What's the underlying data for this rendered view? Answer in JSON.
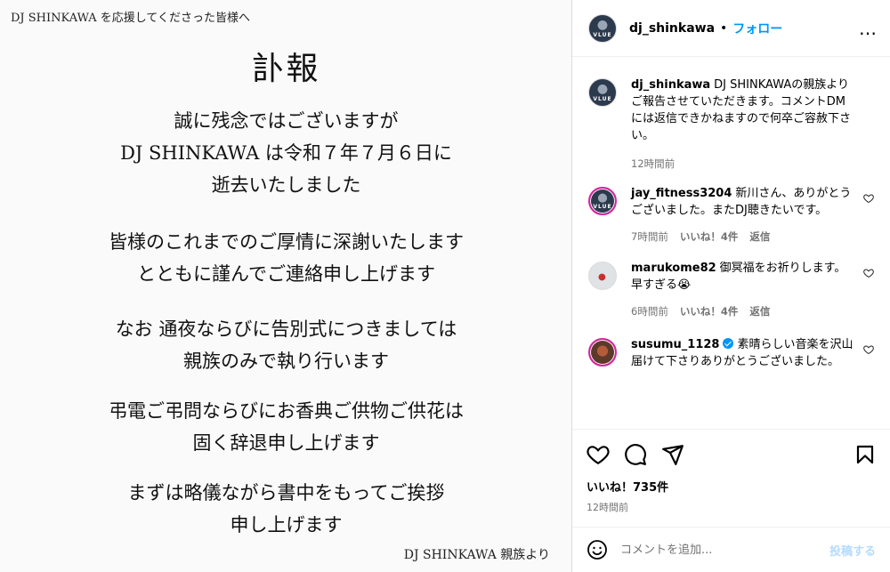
{
  "notice": {
    "header": "DJ SHINKAWA を応援してくださった皆様へ",
    "title": "訃報",
    "paragraphs": [
      [
        "誠に残念ではございますが",
        "DJ SHINKAWA は令和７年７月６日に",
        "逝去いたしました"
      ],
      [
        "皆様のこれまでのご厚情に深謝いたします",
        "とともに謹んでご連絡申し上げます"
      ],
      [
        "なお 通夜ならびに告別式につきましては",
        "親族のみで執り行います"
      ],
      [
        "弔電ご弔問ならびにお香典ご供物ご供花は",
        "固く辞退申し上げます"
      ],
      [
        "まずは略儀ながら書中をもってご挨拶",
        "申し上げます"
      ]
    ],
    "footer": "DJ SHINKAWA 親族より"
  },
  "post_header": {
    "username": "dj_shinkawa",
    "dot": "•",
    "follow_label": "フォロー",
    "more_icon": "…",
    "avatar_text": "VLUE"
  },
  "caption": {
    "username": "dj_shinkawa",
    "text": "DJ SHINKAWAの親族よりご報告させていただきます。コメントDMには返信できかねますので何卒ご容赦下さい。",
    "time": "12時間前"
  },
  "comments": [
    {
      "username": "jay_fitness3204",
      "text": "新川さん、ありがとうございました。またDJ聴きたいです。",
      "time": "7時間前",
      "likes": "いいね！4件",
      "reply": "返信",
      "verified": false
    },
    {
      "username": "marukome82",
      "text": "御冥福をお祈りします。",
      "text2": "早すぎる😭",
      "time": "6時間前",
      "likes": "いいね！4件",
      "reply": "返信",
      "verified": false
    },
    {
      "username": "susumu_1128",
      "text": "素晴らしい音楽を沢山届けて下さりありがとうございました。",
      "verified": true
    }
  ],
  "engagement": {
    "likes": "いいね！735件",
    "time": "12時間前"
  },
  "comment_box": {
    "placeholder": "コメントを追加...",
    "post_label": "投稿する"
  }
}
